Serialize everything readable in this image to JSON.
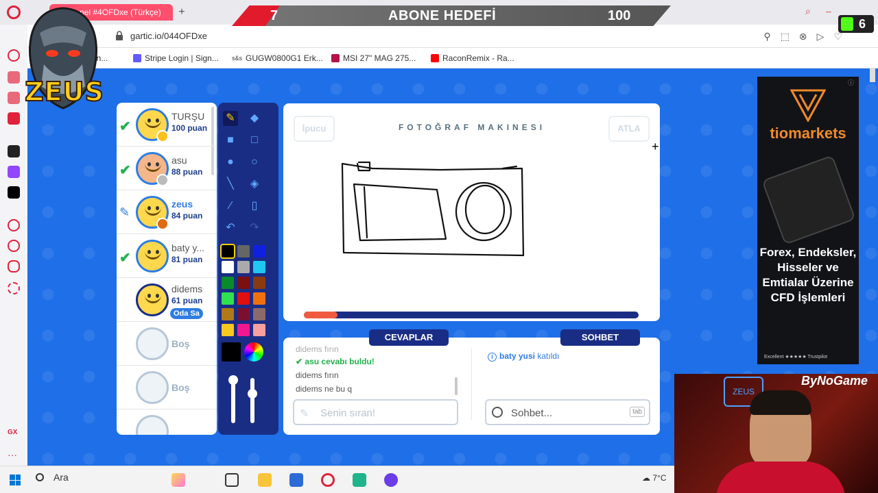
{
  "browser": {
    "tab_title": "nel #4OFDxe (Türkçe)",
    "new_tab": "+",
    "url": "gartic.io/044OFDxe",
    "bookmarks": [
      {
        "label": "min...",
        "color": "#888888"
      },
      {
        "label": "Stripe Login | Sign...",
        "color": "#635bff"
      },
      {
        "label": "GUGW0800G1 Erk...",
        "color": "#444444"
      },
      {
        "label": "MSI 27\" MAG 275...",
        "color": "#b5124a"
      },
      {
        "label": "RaconRemix - Ra...",
        "color": "#ff0000"
      }
    ],
    "bookmark_prefix": "s&s"
  },
  "overlay": {
    "goal_current": "7",
    "goal_title": "ABONE HEDEFİ",
    "goal_target": "100",
    "logo_text": "ZEUS",
    "sub_count": "6",
    "webcam_brand": "ByNoGame"
  },
  "game": {
    "word": "FOTOĞRAF MAKINESI",
    "hint_label": "İpucu",
    "skip_label": "ATLA",
    "timer_fraction": 0.1,
    "answers_title": "CEVAPLAR",
    "chat_title": "SOHBET",
    "answers": [
      {
        "user": "didems",
        "text": "fırın",
        "partial": true
      },
      {
        "system": "asu cevabı buldu!"
      },
      {
        "user": "didems",
        "text": "fırın"
      },
      {
        "user": "didems",
        "text": "ne bu q"
      }
    ],
    "answer_placeholder": "Senin sıran!",
    "chat_placeholder": "Sohbet...",
    "chat_tab_hint": "tab",
    "chat_messages": [
      {
        "user": "baty yusi",
        "text": "katıldı"
      }
    ]
  },
  "players": [
    {
      "name": "TURŞU",
      "score": "100 puan",
      "state": "guessed",
      "badge": "#ffc020"
    },
    {
      "name": "asu",
      "score": "88 puan",
      "state": "guessed",
      "badge": "#bbbbbb"
    },
    {
      "name": "zeus",
      "score": "84 puan",
      "state": "drawing",
      "badge": "#e06a12"
    },
    {
      "name": "baty y...",
      "score": "81 puan",
      "state": "guessed",
      "badge": ""
    },
    {
      "name": "didems",
      "score": "61 puan",
      "state": "host",
      "badge": "",
      "host_label": "Oda Sa"
    },
    {
      "name": "Boş",
      "state": "empty"
    },
    {
      "name": "Boş",
      "state": "empty"
    }
  ],
  "ad": {
    "brand": "tiomarkets",
    "text": "Forex, Endeksler, Hisseler ve Emtialar Üzerine CFD İşlemleri",
    "footer": "Excellent ★★★★★ Trustpilot",
    "badge": "AdChoi"
  },
  "taskbar": {
    "search_label": "Ara",
    "weather": "7°C"
  }
}
